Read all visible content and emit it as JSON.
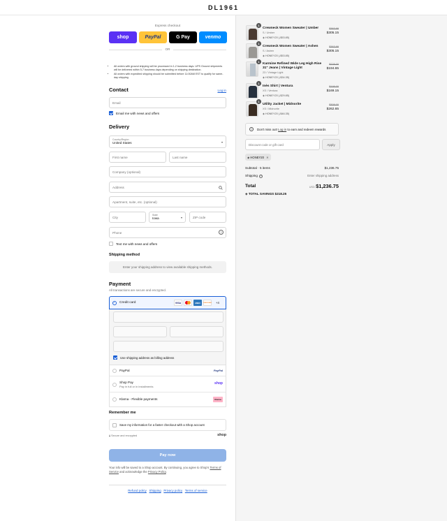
{
  "brand": "DL1961",
  "express": {
    "title": "Express checkout",
    "or": "OR",
    "buttons": [
      {
        "label": "shop",
        "color": "#5a31f4"
      },
      {
        "label": "PayPal",
        "color": "#ffc439"
      },
      {
        "label": "G Pay",
        "color": "#000000"
      },
      {
        "label": "venmo",
        "color": "#008cff"
      }
    ]
  },
  "notices": [
    "All orders with ground shipping will be processed in 1-2 business days. UPS Ground shipments will be delivered within 5-7 business days depending on shipping destination.",
    "All orders with expedited shipping should be submitted before 11:00AM EST to qualify for same-day shipping."
  ],
  "contact": {
    "heading": "Contact",
    "login": "Log in",
    "email_placeholder": "Email",
    "news_label": "Email me with news and offers"
  },
  "delivery": {
    "heading": "Delivery",
    "country_label": "Country/Region",
    "country_value": "United States",
    "first_name": "First name",
    "last_name": "Last name",
    "company": "Company (optional)",
    "address": "Address",
    "apartment": "Apartment, suite, etc. (optional)",
    "city": "City",
    "state_label": "State",
    "state_value": "Iowa",
    "zip": "ZIP code",
    "phone": "Phone",
    "text_label": "Text me with news and offers"
  },
  "shipping_method": {
    "heading": "Shipping method",
    "placeholder": "Enter your shipping address to view available shipping methods."
  },
  "payment": {
    "heading": "Payment",
    "subtitle": "All transactions are secure and encrypted.",
    "credit_card": "Credit card",
    "card_brands": [
      "VISA",
      "MC",
      "AMEX",
      "DISCOVER"
    ],
    "more_cards": "+4",
    "billing_label": "Use shipping address as billing address",
    "options": [
      {
        "label": "PayPal",
        "sub": "",
        "badge": "PayPal"
      },
      {
        "label": "Shop Pay",
        "sub": "Pay in full or in installments",
        "badge": "shop"
      },
      {
        "label": "Klarna - Flexible payments",
        "sub": "",
        "badge": "Klarna"
      }
    ]
  },
  "remember": {
    "heading": "Remember me",
    "save_label": "Save my information for a faster checkout with a Shop account",
    "secure": "Secure and encrypted",
    "shop": "shop"
  },
  "pay_button": "Pay now",
  "terms": {
    "line1": "Your info will be saved to a Shop account. By continuing, you agree to Shop's",
    "tos": "Terms of Service",
    "and": "and acknowledge the",
    "privacy": "Privacy Policy",
    "end": "."
  },
  "footer_links": [
    "Refund policy",
    "Shipping",
    "Privacy policy",
    "Terms of service"
  ],
  "cart": {
    "items": [
      {
        "qty": "1",
        "name": "Crewneck Women Sweater | Umber",
        "variant": "S / Umber",
        "discount": "HONEY20 (-$53.85)",
        "orig": "$363.99",
        "price": "$305.15"
      },
      {
        "qty": "1",
        "name": "Crewneck Women Sweater | Ashen",
        "variant": "S / Ashen",
        "discount": "HONEY20 (-$53.85)",
        "orig": "$363.99",
        "price": "$305.15"
      },
      {
        "qty": "1",
        "name": "Karmine Refined Wide Leg High Rise 31\" Jeans | Vintage Light",
        "variant": "23 / Vintage Light",
        "discount": "HONEY20 (-$34.35)",
        "orig": "$229.00",
        "price": "$194.65"
      },
      {
        "qty": "1",
        "name": "Inès Shirt | Ventura",
        "variant": "XS / Ventura",
        "discount": "HONEY20 (-$29.85)",
        "orig": "$199.00",
        "price": "$169.15"
      },
      {
        "qty": "1",
        "name": "Utility Jacket | Midnorite",
        "variant": "XS / Midnorite",
        "discount": "HONEY20 (-$46.35)",
        "orig": "$309.00",
        "price": "$262.65"
      }
    ],
    "rewards_text": "Don't miss out!",
    "rewards_link": "Log in",
    "rewards_rest": "to earn and redeem rewards",
    "discount_placeholder": "Discount code or gift card",
    "apply": "Apply",
    "code_chip": "HONEY20",
    "subtotal_label": "Subtotal · 5 items",
    "subtotal": "$1,236.75",
    "shipping_label": "Shipping",
    "shipping_value": "Enter shipping address",
    "total_label": "Total",
    "currency": "USD",
    "total": "$1,236.75",
    "savings_label": "TOTAL SAVINGS",
    "savings": "$218.25"
  }
}
